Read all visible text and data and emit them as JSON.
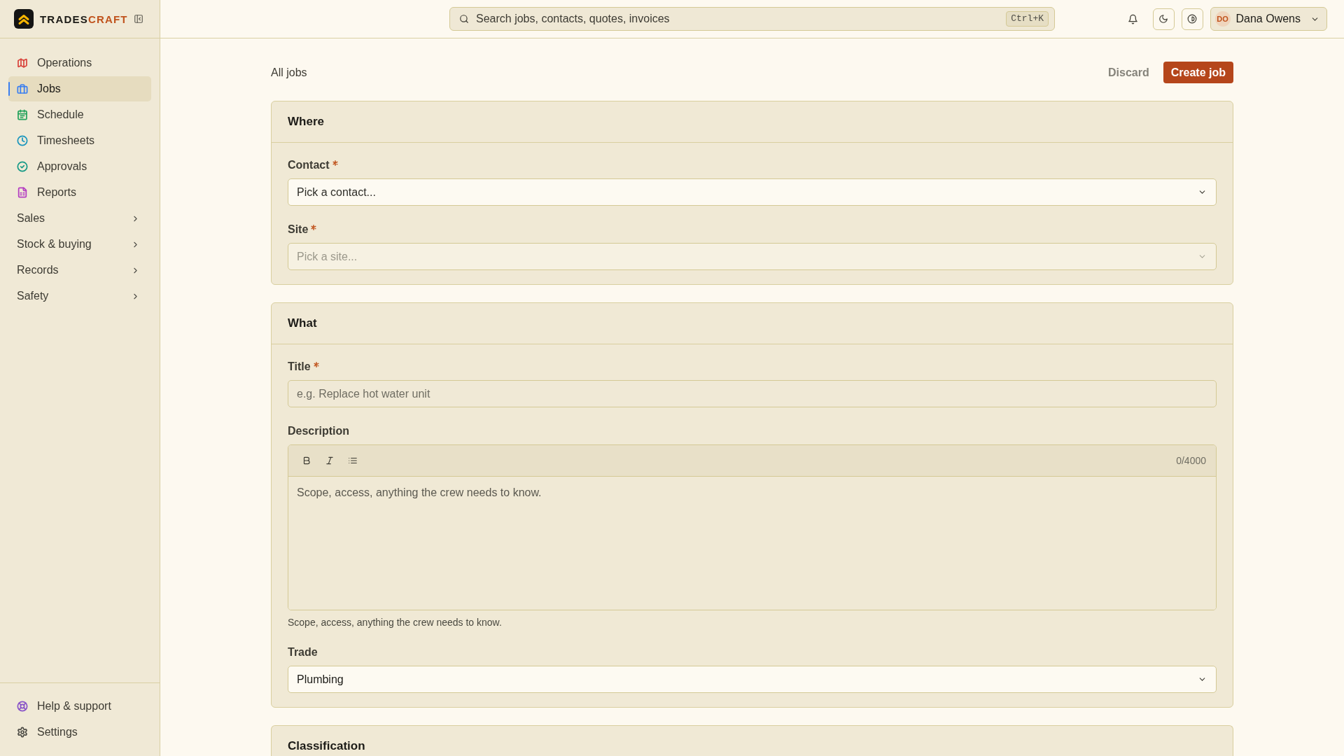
{
  "sidebar": {
    "brand": {
      "primary": "TRADES",
      "accent": "CRAFT"
    },
    "nav": [
      {
        "kind": "link",
        "label": "Operations",
        "color": "#d9463e",
        "selected": false
      },
      {
        "kind": "link",
        "label": "Jobs",
        "color": "#3b7ff0",
        "selected": true
      },
      {
        "kind": "link",
        "label": "Schedule",
        "color": "#25a35c",
        "selected": false
      },
      {
        "kind": "link",
        "label": "Timesheets",
        "color": "#1b96bd",
        "selected": false
      },
      {
        "kind": "link",
        "label": "Approvals",
        "color": "#169a86",
        "selected": false
      },
      {
        "kind": "link",
        "label": "Reports",
        "color": "#b43fc2",
        "selected": false
      },
      {
        "kind": "group",
        "label": "Sales",
        "expanded": false,
        "selected": false
      },
      {
        "kind": "group",
        "label": "Stock & buying",
        "expanded": false,
        "selected": false
      },
      {
        "kind": "group",
        "label": "Records",
        "expanded": false,
        "selected": false
      },
      {
        "kind": "group",
        "label": "Safety",
        "expanded": false,
        "selected": false
      }
    ],
    "footer": [
      {
        "label": "Help & support",
        "color": "#8a55c8",
        "selected": false
      },
      {
        "label": "Settings",
        "color": "#4e4d46",
        "selected": false
      }
    ]
  },
  "topbar": {
    "search": {
      "placeholder": "Search jobs, contacts, quotes, invoices",
      "shortcut": "Ctrl+K"
    },
    "user": {
      "initials": "DO",
      "name": "Dana Owens"
    }
  },
  "page": {
    "breadcrumb": "All jobs",
    "actions": [
      {
        "kind": "secondary",
        "label": "Discard"
      },
      {
        "kind": "primary",
        "label": "Create job"
      }
    ]
  },
  "sections": [
    {
      "title": "Where",
      "fields": [
        {
          "kind": "select",
          "label": "Contact",
          "required": true,
          "placeholder": "Pick a contact...",
          "disabled": false
        },
        {
          "kind": "select",
          "label": "Site",
          "required": true,
          "placeholder": "Pick a site...",
          "disabled": true
        }
      ]
    },
    {
      "title": "What",
      "fields": [
        {
          "kind": "text",
          "label": "Title",
          "required": true,
          "placeholder": "e.g. Replace hot water unit"
        },
        {
          "kind": "editor",
          "label": "Description",
          "required": false,
          "counter": "0/4000",
          "placeholder": "Scope, access, anything the crew needs to know.",
          "helper": "Scope, access, anything the crew needs to know."
        },
        {
          "kind": "select",
          "label": "Trade",
          "required": false,
          "value": "Plumbing",
          "disabled": false
        }
      ]
    },
    {
      "title": "Classification"
    }
  ]
}
